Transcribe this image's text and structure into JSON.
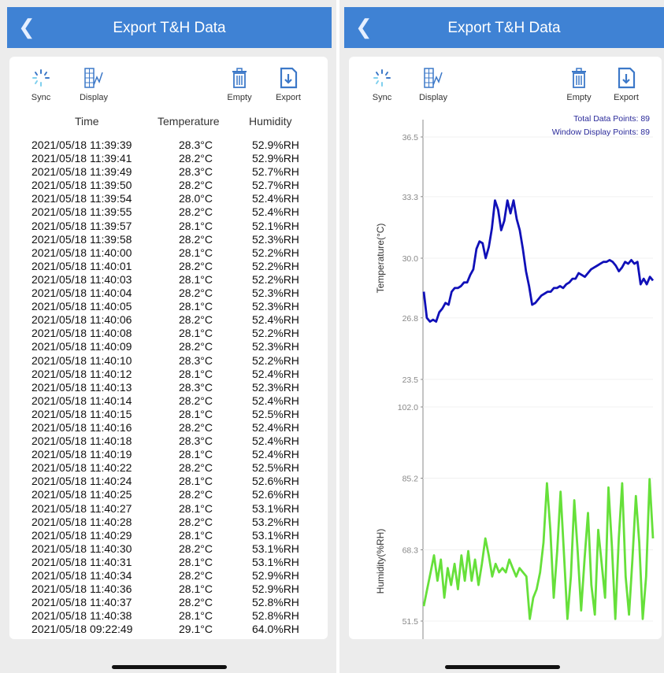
{
  "screen_title": "Export T&H Data",
  "toolbar": {
    "sync_label": "Sync",
    "display_label": "Display",
    "empty_label": "Empty",
    "export_label": "Export"
  },
  "table": {
    "headers": [
      "Time",
      "Temperature",
      "Humidity"
    ],
    "rows": [
      [
        "2021/05/18 11:39:39",
        "28.3°C",
        "52.9%RH"
      ],
      [
        "2021/05/18 11:39:41",
        "28.2°C",
        "52.9%RH"
      ],
      [
        "2021/05/18 11:39:49",
        "28.3°C",
        "52.7%RH"
      ],
      [
        "2021/05/18 11:39:50",
        "28.2°C",
        "52.7%RH"
      ],
      [
        "2021/05/18 11:39:54",
        "28.0°C",
        "52.4%RH"
      ],
      [
        "2021/05/18 11:39:55",
        "28.2°C",
        "52.4%RH"
      ],
      [
        "2021/05/18 11:39:57",
        "28.1°C",
        "52.1%RH"
      ],
      [
        "2021/05/18 11:39:58",
        "28.2°C",
        "52.3%RH"
      ],
      [
        "2021/05/18 11:40:00",
        "28.1°C",
        "52.2%RH"
      ],
      [
        "2021/05/18 11:40:01",
        "28.2°C",
        "52.2%RH"
      ],
      [
        "2021/05/18 11:40:03",
        "28.1°C",
        "52.2%RH"
      ],
      [
        "2021/05/18 11:40:04",
        "28.2°C",
        "52.3%RH"
      ],
      [
        "2021/05/18 11:40:05",
        "28.1°C",
        "52.3%RH"
      ],
      [
        "2021/05/18 11:40:06",
        "28.2°C",
        "52.4%RH"
      ],
      [
        "2021/05/18 11:40:08",
        "28.1°C",
        "52.2%RH"
      ],
      [
        "2021/05/18 11:40:09",
        "28.2°C",
        "52.3%RH"
      ],
      [
        "2021/05/18 11:40:10",
        "28.3°C",
        "52.2%RH"
      ],
      [
        "2021/05/18 11:40:12",
        "28.1°C",
        "52.4%RH"
      ],
      [
        "2021/05/18 11:40:13",
        "28.3°C",
        "52.3%RH"
      ],
      [
        "2021/05/18 11:40:14",
        "28.2°C",
        "52.4%RH"
      ],
      [
        "2021/05/18 11:40:15",
        "28.1°C",
        "52.5%RH"
      ],
      [
        "2021/05/18 11:40:16",
        "28.2°C",
        "52.4%RH"
      ],
      [
        "2021/05/18 11:40:18",
        "28.3°C",
        "52.4%RH"
      ],
      [
        "2021/05/18 11:40:19",
        "28.1°C",
        "52.4%RH"
      ],
      [
        "2021/05/18 11:40:22",
        "28.2°C",
        "52.5%RH"
      ],
      [
        "2021/05/18 11:40:24",
        "28.1°C",
        "52.6%RH"
      ],
      [
        "2021/05/18 11:40:25",
        "28.2°C",
        "52.6%RH"
      ],
      [
        "2021/05/18 11:40:27",
        "28.1°C",
        "53.1%RH"
      ],
      [
        "2021/05/18 11:40:28",
        "28.2°C",
        "53.2%RH"
      ],
      [
        "2021/05/18 11:40:29",
        "28.1°C",
        "53.1%RH"
      ],
      [
        "2021/05/18 11:40:30",
        "28.2°C",
        "53.1%RH"
      ],
      [
        "2021/05/18 11:40:31",
        "28.1°C",
        "53.1%RH"
      ],
      [
        "2021/05/18 11:40:34",
        "28.2°C",
        "52.9%RH"
      ],
      [
        "2021/05/18 11:40:36",
        "28.1°C",
        "52.9%RH"
      ],
      [
        "2021/05/18 11:40:37",
        "28.2°C",
        "52.8%RH"
      ],
      [
        "2021/05/18 11:40:38",
        "28.1°C",
        "52.8%RH"
      ],
      [
        "2021/05/18 09:22:49",
        "29.1°C",
        "64.0%RH"
      ]
    ]
  },
  "info": {
    "total_points": "Total Data Points: 89",
    "window_points": "Window Display Points: 89"
  },
  "colors": {
    "header": "#3f82d4",
    "temperature_line": "#1010b8",
    "humidity_line": "#66e03a",
    "info_text": "#2a2a9a",
    "icon_blue": "#3c78c8"
  },
  "chart_data": [
    {
      "type": "line",
      "ylabel": "Temperature(°C)",
      "yticks": [
        "36.5",
        "33.3",
        "30.0",
        "26.8",
        "23.5"
      ],
      "ylim": [
        23.5,
        36.5
      ],
      "series": [
        {
          "values": [
            28.2,
            26.8,
            26.6,
            26.7,
            26.6,
            27.1,
            27.3,
            27.6,
            27.5,
            28.2,
            28.4,
            28.4,
            28.5,
            28.7,
            28.7,
            29.1,
            29.4,
            30.5,
            30.9,
            30.8,
            30.0,
            30.6,
            31.6,
            33.1,
            32.6,
            31.5,
            32.0,
            33.1,
            32.4,
            33.1,
            32.1,
            31.5,
            30.5,
            29.3,
            28.5,
            27.5,
            27.6,
            27.8,
            28.0,
            28.1,
            28.2,
            28.2,
            28.4,
            28.4,
            28.5,
            28.4,
            28.6,
            28.7,
            28.9,
            28.9,
            29.2,
            29.1,
            29.0,
            29.2,
            29.4,
            29.5,
            29.6,
            29.7,
            29.8,
            29.8,
            29.9,
            29.8,
            29.6,
            29.3,
            29.5,
            29.8,
            29.7,
            29.9,
            29.7,
            29.8,
            28.6,
            28.9,
            28.6,
            29.0,
            28.8
          ]
        }
      ],
      "grid": true
    },
    {
      "type": "line",
      "ylabel": "Humidity(%RH)",
      "yticks": [
        "102.0",
        "85.2",
        "68.3",
        "51.5"
      ],
      "ylim": [
        45.0,
        102.0
      ],
      "series": [
        {
          "values": [
            55,
            59,
            63,
            67,
            61,
            66,
            57,
            64,
            60,
            65,
            59,
            67,
            61,
            68,
            61,
            66,
            60,
            65,
            71,
            67,
            62,
            65,
            63,
            64,
            63,
            66,
            64,
            62,
            64,
            63,
            62,
            52,
            57,
            59,
            63,
            70,
            84,
            73,
            57,
            68,
            82,
            67,
            52,
            62,
            80,
            68,
            54,
            66,
            77,
            60,
            53,
            73,
            65,
            57,
            83,
            69,
            52,
            71,
            84,
            62,
            53,
            66,
            81,
            70,
            52,
            62,
            85,
            71
          ]
        }
      ],
      "grid": true
    }
  ]
}
